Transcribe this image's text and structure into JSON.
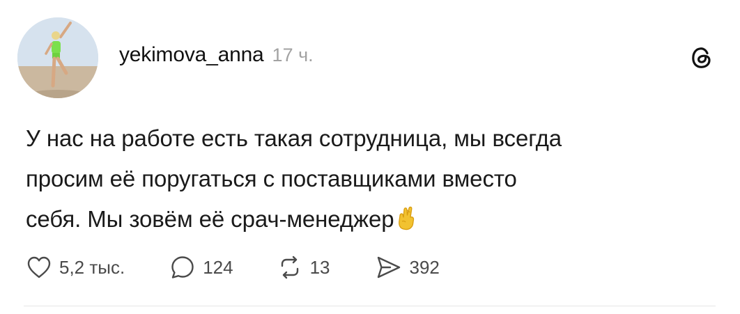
{
  "post": {
    "author": {
      "username": "yekimova_anna",
      "avatar_icon": "profile-photo-avatar"
    },
    "timestamp": "17 ч.",
    "menu_icon": "threads-logo-icon",
    "text_lines": [
      "У нас на работе есть такая сотрудница, мы всегда",
      "просим её поругаться с поставщиками вместо",
      "себя. Мы зовём её срач-менеджер"
    ],
    "emoji": "crossed-fingers-emoji",
    "actions": {
      "like": {
        "icon": "heart-icon",
        "count": "5,2 тыс."
      },
      "comment": {
        "icon": "comment-bubble-icon",
        "count": "124"
      },
      "repost": {
        "icon": "repost-icon",
        "count": "13"
      },
      "share": {
        "icon": "send-icon",
        "count": "392"
      }
    }
  },
  "colors": {
    "text": "#1a1a1a",
    "muted": "#a2a2a2",
    "icon": "#4a4a4a",
    "emoji": "#f2c230"
  }
}
